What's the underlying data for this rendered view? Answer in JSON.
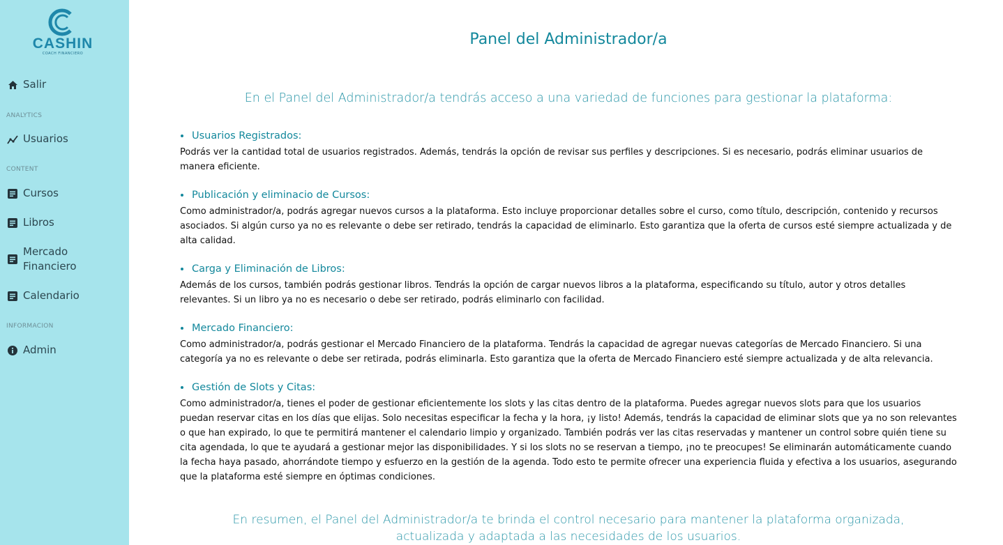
{
  "sidebar": {
    "logo": {
      "name": "CASHIN",
      "tagline": "COACH FINANCIERO"
    },
    "items": [
      {
        "label": "Salir",
        "icon": "home-icon"
      },
      {
        "label": "Usuarios",
        "icon": "analytics-icon"
      },
      {
        "label": "Cursos",
        "icon": "document-icon"
      },
      {
        "label": "Libros",
        "icon": "document-icon"
      },
      {
        "label": "Mercado Financiero",
        "icon": "document-icon"
      },
      {
        "label": "Calendario",
        "icon": "document-icon"
      },
      {
        "label": "Admin",
        "icon": "info-icon"
      }
    ],
    "sections": [
      "ANALYTICS",
      "CONTENT",
      "INFORMACION"
    ]
  },
  "main": {
    "title": "Panel del Administrador/a",
    "intro": "En el Panel del Administrador/a tendrás acceso a una variedad de funciones para gestionar la plataforma:",
    "features": [
      {
        "title": "Usuarios Registrados:",
        "text": "Podrás ver la cantidad total de usuarios registrados. Además, tendrás la opción de revisar sus perfiles y descripciones. Si es necesario, podrás eliminar usuarios de manera eficiente."
      },
      {
        "title": "Publicación y eliminacio de Cursos:",
        "text": "Como administrador/a, podrás agregar nuevos cursos a la plataforma. Esto incluye proporcionar detalles sobre el curso, como título, descripción, contenido y recursos asociados. Si algún curso ya no es relevante o debe ser retirado, tendrás la capacidad de eliminarlo. Esto garantiza que la oferta de cursos esté siempre actualizada y de alta calidad."
      },
      {
        "title": "Carga y Eliminación de Libros:",
        "text": "Además de los cursos, también podrás gestionar libros. Tendrás la opción de cargar nuevos libros a la plataforma, especificando su título, autor y otros detalles relevantes. Si un libro ya no es necesario o debe ser retirado, podrás eliminarlo con facilidad."
      },
      {
        "title": "Mercado Financiero:",
        "text": "Como administrador/a, podrás gestionar el Mercado Financiero de la plataforma. Tendrás la capacidad de agregar nuevas categorías de Mercado Financiero. Si una categoría ya no es relevante o debe ser retirada, podrás eliminarla. Esto garantiza que la oferta de Mercado Financiero esté siempre actualizada y de alta relevancia."
      },
      {
        "title": "Gestión de Slots y Citas:",
        "text": "Como administrador/a, tienes el poder de gestionar eficientemente los slots y las citas dentro de la plataforma. Puedes agregar nuevos slots para que los usuarios puedan reservar citas en los días que elijas. Solo necesitas especificar la fecha y la hora, ¡y listo! Además, tendrás la capacidad de eliminar slots que ya no son relevantes o que han expirado, lo que te permitirá mantener el calendario limpio y organizado. También podrás ver las citas reservadas y mantener un control sobre quién tiene su cita agendada, lo que te ayudará a gestionar mejor las disponibilidades. Y si los slots no se reservan a tiempo, ¡no te preocupes! Se eliminarán automáticamente cuando la fecha haya pasado, ahorrándote tiempo y esfuerzo en la gestión de la agenda. Todo esto te permite ofrecer una experiencia fluida y efectiva a los usuarios, asegurando que la plataforma esté siempre en óptimas condiciones."
      }
    ],
    "summary": "En resumen, el Panel del Administrador/a te brinda el control necesario para mantener la plataforma organizada, actualizada y adaptada a las necesidades de los usuarios."
  },
  "colors": {
    "sidebar_bg": "#a6e4ec",
    "accent": "#13889c",
    "logo": "#1e87aa"
  }
}
